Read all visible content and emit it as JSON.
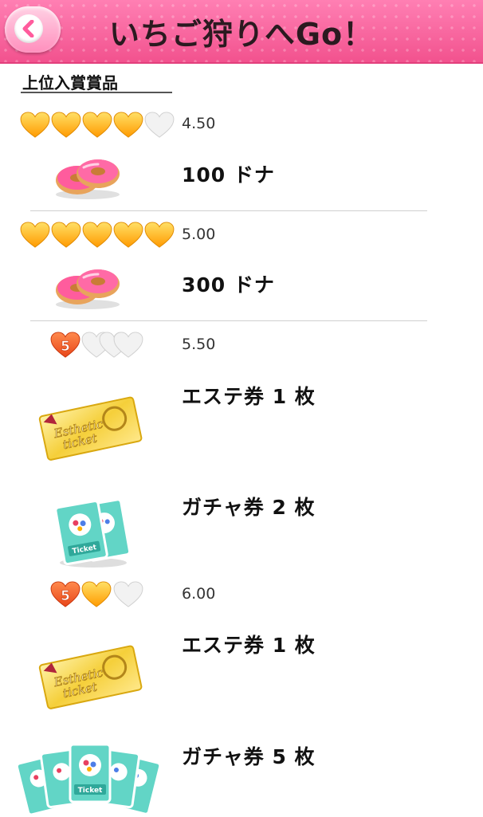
{
  "header": {
    "title": "いちご狩りへGo！"
  },
  "section": {
    "title": "上位入賞賞品"
  },
  "tiers": [
    {
      "score": "4.50",
      "hearts": "gold,gold,gold,gold,half-gold",
      "rewards": [
        "100 ドナ"
      ]
    },
    {
      "score": "5.00",
      "hearts": "gold,gold,gold,gold,gold",
      "rewards": [
        "300 ドナ"
      ]
    },
    {
      "score": "5.50",
      "hearts": "orange-5,half-gold,empty,empty",
      "badge": "5",
      "rewards": [
        "エステ券 1 枚",
        "ガチャ券 2 枚"
      ]
    },
    {
      "score": "6.00",
      "hearts": "orange-5,gold,empty",
      "badge": "5",
      "rewards": [
        "エステ券 1 枚",
        "ガチャ券 5 枚"
      ]
    }
  ],
  "icons": {
    "donut_label": "donut-icon",
    "esthetic_ticket_text": [
      "Esthetic",
      "ticket"
    ],
    "gacha_ticket_text": "Ticket"
  },
  "colors": {
    "header": "#f2528e",
    "heart_gold": "#ffb000",
    "heart_orange": "#f05a23"
  }
}
